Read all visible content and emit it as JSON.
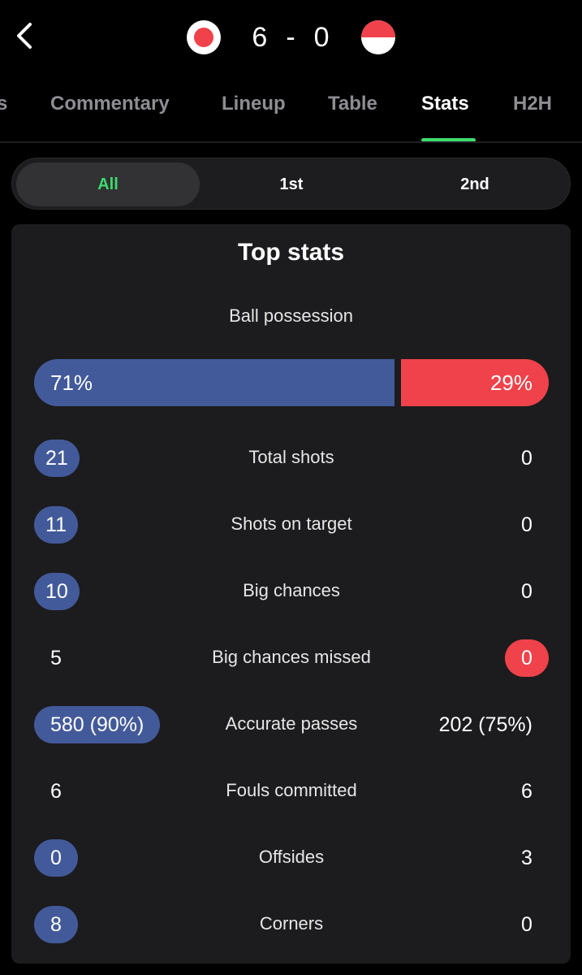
{
  "header": {
    "back_icon": "chevron-left-icon",
    "home_flag": "japan-flag-icon",
    "away_flag": "indonesia-flag-icon",
    "home_score": "6",
    "separator": "-",
    "away_score": "0"
  },
  "tabs": [
    {
      "label": "s"
    },
    {
      "label": "Commentary"
    },
    {
      "label": "Lineup"
    },
    {
      "label": "Table"
    },
    {
      "label": "Stats",
      "active": true
    },
    {
      "label": "H2H"
    }
  ],
  "period_filter": [
    {
      "label": "All",
      "active": true
    },
    {
      "label": "1st"
    },
    {
      "label": "2nd"
    }
  ],
  "colors": {
    "accent_green": "#3ddc6e",
    "home_blue": "#435a9a",
    "away_red": "#f0424a",
    "background": "#000000",
    "card": "#1c1c1e"
  },
  "top_stats": {
    "title": "Top stats",
    "possession": {
      "label": "Ball possession",
      "home_text": "71%",
      "away_text": "29%",
      "home_value": 71,
      "away_value": 29
    },
    "rows": [
      {
        "label": "Total shots",
        "home": "21",
        "away": "0",
        "highlight": "home"
      },
      {
        "label": "Shots on target",
        "home": "11",
        "away": "0",
        "highlight": "home"
      },
      {
        "label": "Big chances",
        "home": "10",
        "away": "0",
        "highlight": "home"
      },
      {
        "label": "Big chances missed",
        "home": "5",
        "away": "0",
        "highlight": "away"
      },
      {
        "label": "Accurate passes",
        "home": "580 (90%)",
        "away": "202 (75%)",
        "highlight": "home"
      },
      {
        "label": "Fouls committed",
        "home": "6",
        "away": "6",
        "highlight": "none"
      },
      {
        "label": "Offsides",
        "home": "0",
        "away": "3",
        "highlight": "home"
      },
      {
        "label": "Corners",
        "home": "8",
        "away": "0",
        "highlight": "home"
      }
    ]
  }
}
